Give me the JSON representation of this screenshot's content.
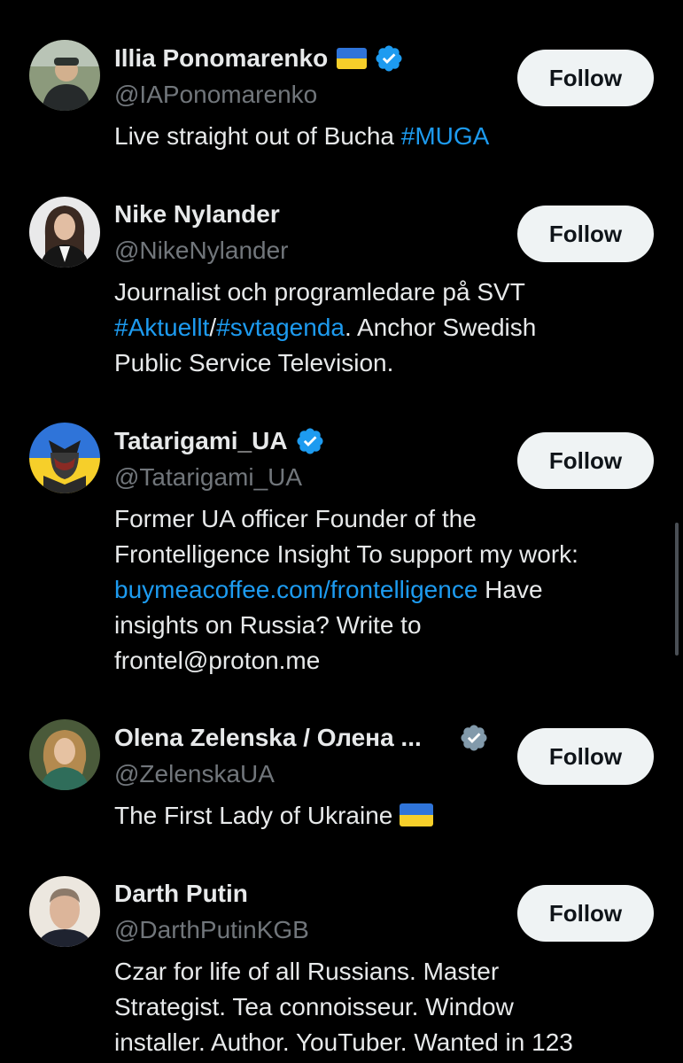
{
  "accounts": [
    {
      "name": "Illia Ponomarenko",
      "handle": "@IAPonomarenko",
      "bio_parts": [
        "Live straight out of Bucha ",
        "#MUGA"
      ],
      "follow_label": "Follow",
      "verified": "blue",
      "flag": "ukraine"
    },
    {
      "name": "Nike Nylander",
      "handle": "@NikeNylander",
      "bio_parts": [
        "Journalist och programledare på SVT",
        "#Aktuellt",
        "/",
        "#svtagenda",
        ". Anchor Swedish",
        "Public Service Television."
      ],
      "follow_label": "Follow"
    },
    {
      "name": "Tatarigami_UA",
      "handle": "@Tatarigami_UA",
      "bio_parts": [
        "Former UA officer Founder of the",
        "Frontelligence Insight To support my work:",
        "buymeacoffee.com/frontelligence",
        " Have",
        "insights on Russia? Write to",
        "frontel@proton.me"
      ],
      "follow_label": "Follow",
      "verified": "blue"
    },
    {
      "name": "Olena Zelenska / Олена ...",
      "handle": "@ZelenskaUA",
      "bio_parts": [
        "The First Lady of Ukraine"
      ],
      "follow_label": "Follow",
      "verified": "gray",
      "bio_flag": "ukraine"
    },
    {
      "name": "Darth Putin",
      "handle": "@DarthPutinKGB",
      "bio_parts": [
        "Czar for life of all Russians. Master",
        "Strategist. Tea connoisseur. Window",
        "installer. Author. YouTuber. Wanted in 123"
      ],
      "follow_label": "Follow"
    }
  ],
  "colors": {
    "background": "#000000",
    "link": "#1d9bf0",
    "verified_blue": "#1d9bf0",
    "verified_gray": "#829aab",
    "follow_button": "#eff3f4"
  }
}
